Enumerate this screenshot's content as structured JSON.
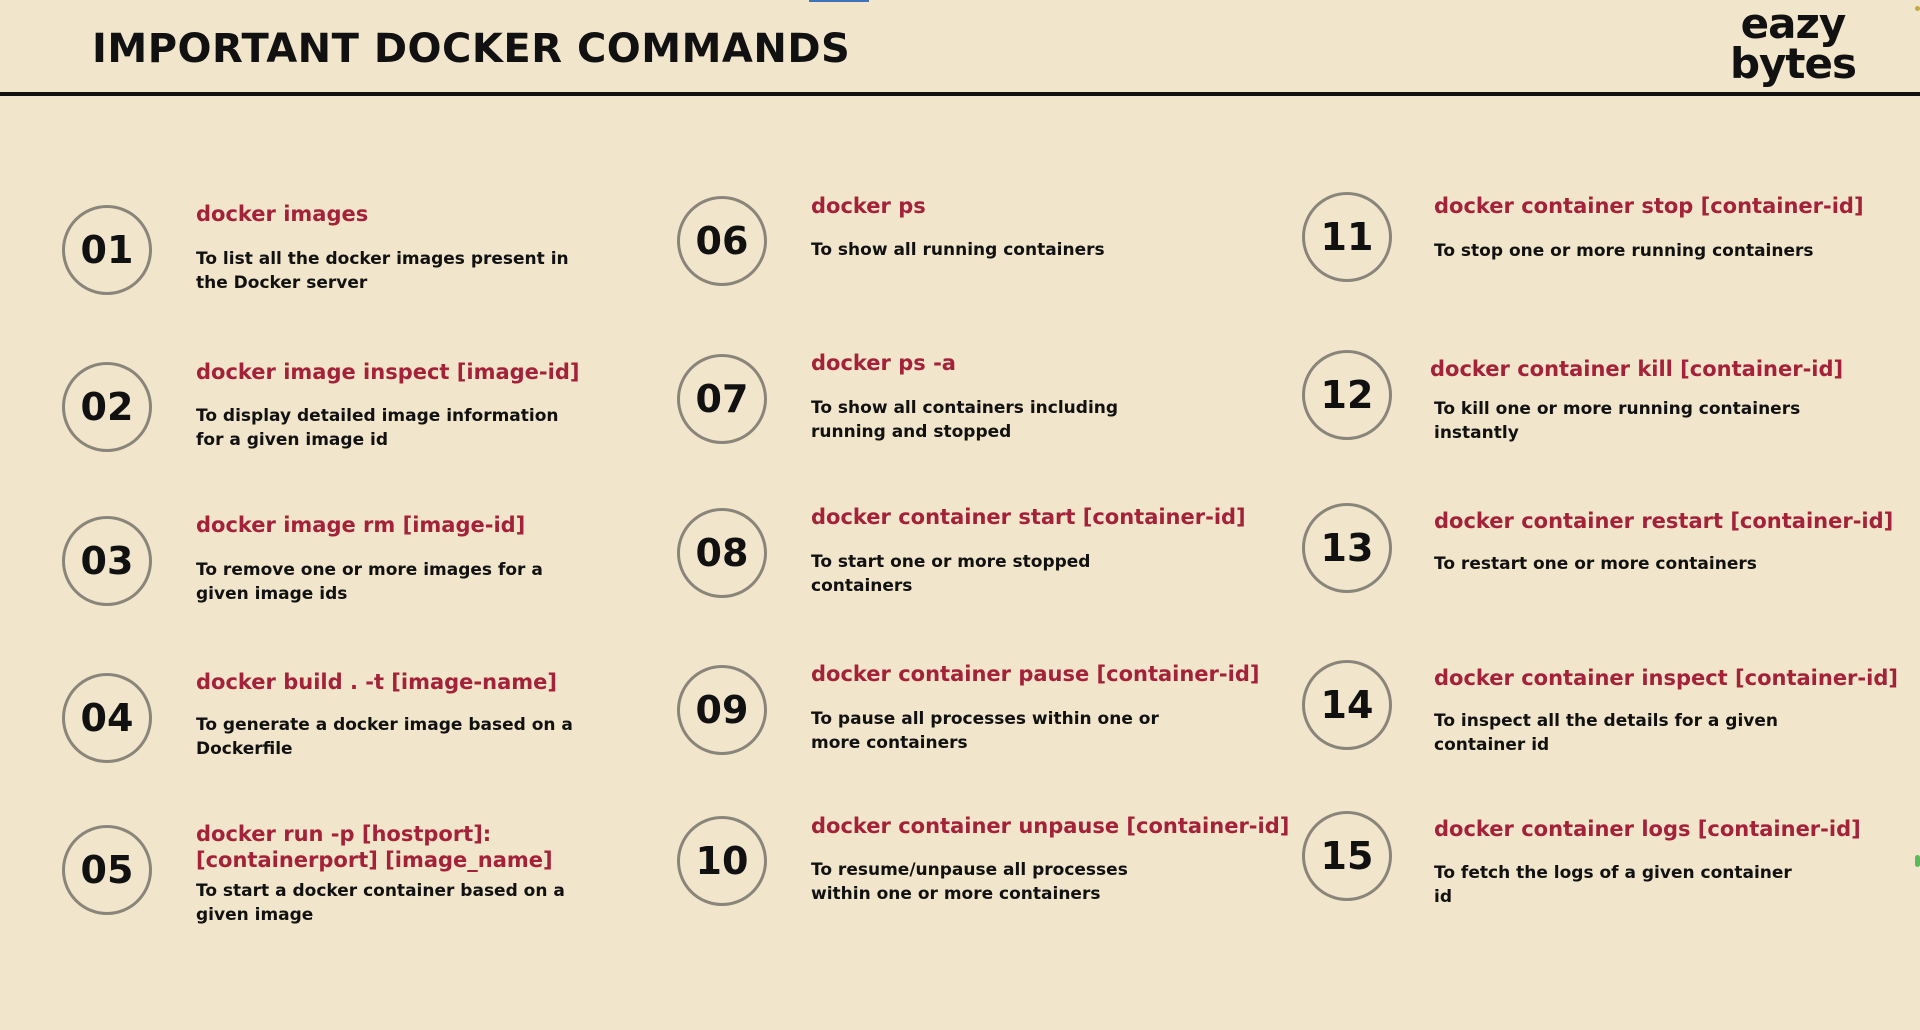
{
  "header": {
    "title": "IMPORTANT DOCKER COMMANDS",
    "logo_line1": "eazy",
    "logo_line2": "bytes"
  },
  "items": [
    {
      "number": "01",
      "command": "docker images",
      "description": "To list all the docker images present in the Docker server"
    },
    {
      "number": "02",
      "command": "docker image inspect [image-id]",
      "description": "To display detailed image information for a given image id"
    },
    {
      "number": "03",
      "command": "docker image rm [image-id]",
      "description": "To remove one or more images for a given image ids"
    },
    {
      "number": "04",
      "command": "docker build . -t [image-name]",
      "description": "To generate a docker image based on a Dockerfile"
    },
    {
      "number": "05",
      "command": "docker run -p [hostport]:[containerport] [image_name]",
      "description": "To start a docker container based on a given image"
    },
    {
      "number": "06",
      "command": "docker ps",
      "description": "To show all running containers"
    },
    {
      "number": "07",
      "command": "docker ps -a",
      "description": "To show all containers including running and stopped"
    },
    {
      "number": "08",
      "command": "docker container start [container-id]",
      "description": "To start one or more stopped containers"
    },
    {
      "number": "09",
      "command": "docker container pause [container-id]",
      "description": "To pause all processes within one or more containers"
    },
    {
      "number": "10",
      "command": "docker container unpause [container-id]",
      "description": "To resume/unpause all processes within one or more containers"
    },
    {
      "number": "11",
      "command": "docker container stop [container-id]",
      "description": "To stop one or more running containers"
    },
    {
      "number": "12",
      "command": "docker container kill [container-id]",
      "description": "To kill one or more running containers instantly"
    },
    {
      "number": "13",
      "command": "docker container restart [container-id]",
      "description": "To restart one or more containers"
    },
    {
      "number": "14",
      "command": "docker container inspect [container-id]",
      "description": "To inspect all the details for a given container id"
    },
    {
      "number": "15",
      "command": "docker container logs [container-id]",
      "description": "To fetch the logs of a given container id"
    }
  ]
}
